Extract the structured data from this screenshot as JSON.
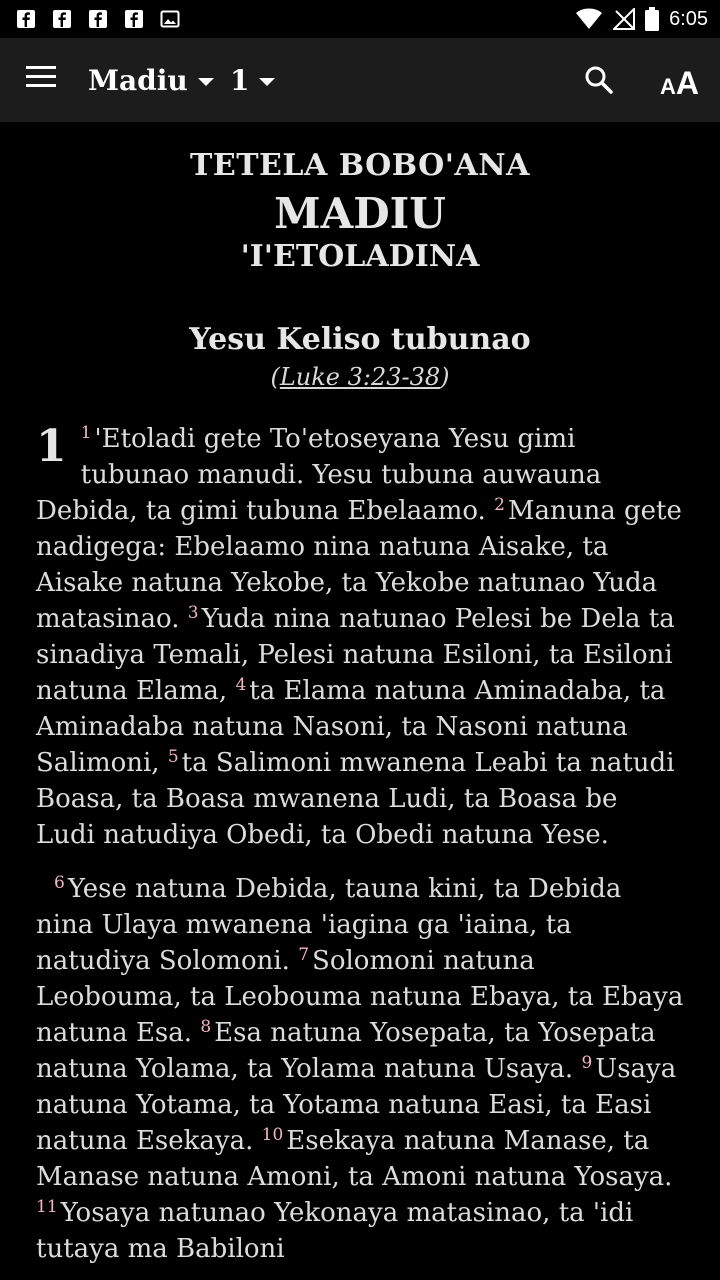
{
  "status_bar": {
    "time": "6:05",
    "notification_icons": [
      "facebook-icon",
      "facebook-icon",
      "facebook-icon",
      "facebook-icon",
      "image-icon"
    ],
    "status_icons": [
      "wifi-icon",
      "no-signal-icon",
      "battery-icon"
    ]
  },
  "toolbar": {
    "book": "Madiu",
    "chapter": "1",
    "icons": [
      "menu-icon",
      "search-icon",
      "text-size-icon"
    ]
  },
  "header": {
    "title_main": "TETELA BOBO'ANA",
    "title_book": "MADIU",
    "title_sub": "'I'ETOLADINA"
  },
  "section": {
    "title": "Yesu Keliso tubunao",
    "ref_open": "(",
    "ref_link": "Luke 3:23-38",
    "ref_close": ")"
  },
  "chapter_number": "1",
  "verses": [
    {
      "n": "1",
      "text": "'Etoladi gete To'etoseyana Yesu gimi tubunao manudi. Yesu tubuna auwauna Debida, ta gimi tubuna Ebelaamo. "
    },
    {
      "n": "2",
      "text": "Manuna gete nadigega: Ebelaamo nina natuna Aisake, ta Aisake natuna Yekobe, ta Yekobe natunao Yuda matasinao. "
    },
    {
      "n": "3",
      "text": "Yuda nina natunao Pelesi be Dela ta sinadiya Temali, Pelesi natuna Esiloni, ta Esiloni natuna Elama, "
    },
    {
      "n": "4",
      "text": "ta Elama natuna Aminadaba, ta Aminadaba natuna Nasoni, ta Nasoni natuna Salimoni, "
    },
    {
      "n": "5",
      "text": "ta Salimoni mwanena Leabi ta natudi Boasa, ta Boasa mwanena Ludi, ta Boasa be Ludi natudiya Obedi, ta Obedi natuna Yese."
    },
    {
      "n": "6",
      "text": "Yese natuna Debida, tauna kini, ta Debida nina Ulaya mwanena 'iagina ga 'iaina, ta natudiya Solomoni. "
    },
    {
      "n": "7",
      "text": "Solomoni natuna Leobouma, ta Leobouma natuna Ebaya, ta Ebaya natuna Esa. "
    },
    {
      "n": "8",
      "text": "Esa natuna Yosepata, ta Yosepata natuna Yolama, ta Yolama natuna Usaya. "
    },
    {
      "n": "9",
      "text": "Usaya natuna Yotama, ta Yotama natuna Easi, ta Easi natuna Esekaya. "
    },
    {
      "n": "10",
      "text": "Esekaya natuna Manase, ta Manase natuna Amoni, ta Amoni natuna Yosaya. "
    },
    {
      "n": "11",
      "text": "Yosaya natunao Yekonaya matasinao, ta 'idi tutaya ma Babiloni"
    }
  ],
  "colors": {
    "background": "#000000",
    "toolbar": "#1c1c1c",
    "text": "#dcdcdc",
    "verse_number": "#f3b5c2"
  }
}
